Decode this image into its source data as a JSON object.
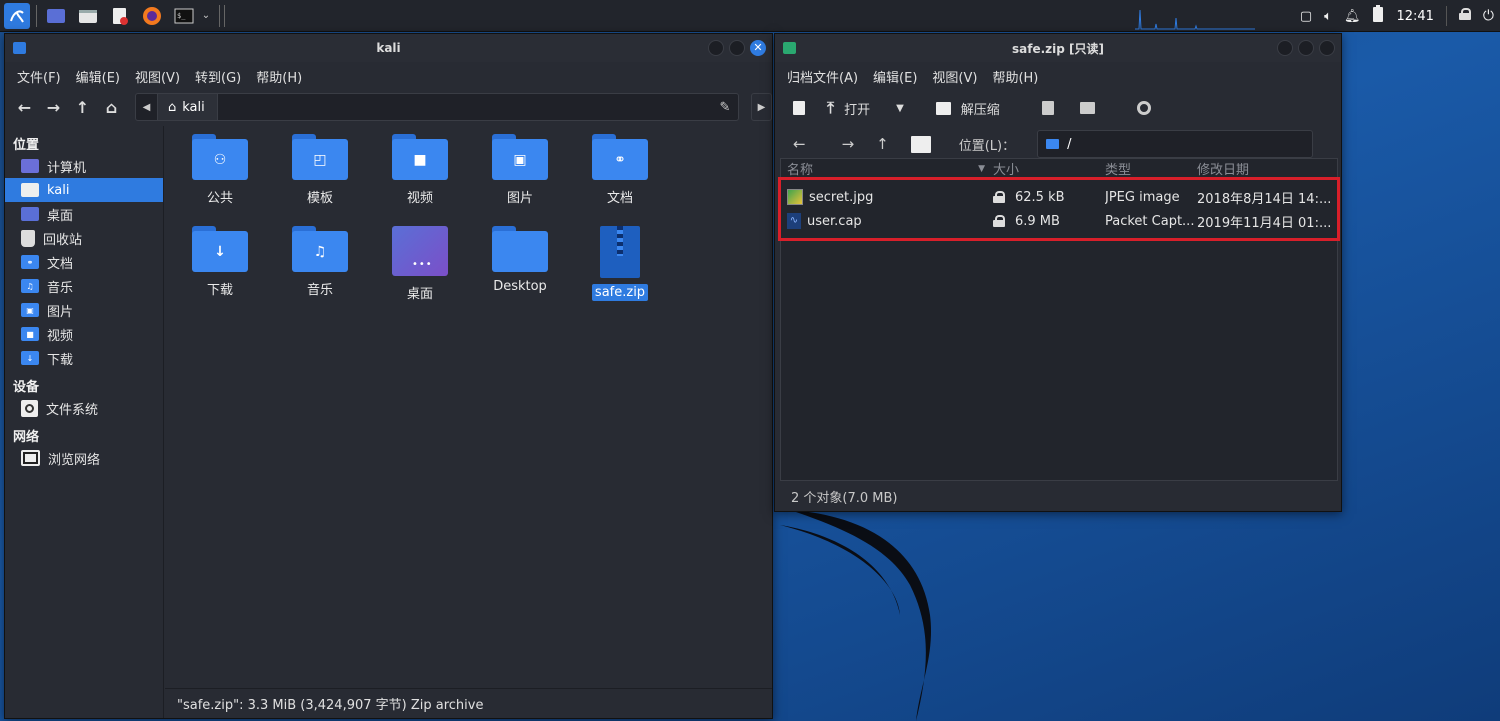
{
  "panel": {
    "clock": "12:41",
    "icons": [
      "kali-menu-icon",
      "desktop-icon",
      "file-manager-icon",
      "text-editor-icon",
      "firefox-icon",
      "terminal-icon"
    ]
  },
  "colors": {
    "accent": "#2f7be0",
    "folder": "#3b87f0",
    "highlight": "#d81f2a"
  },
  "filemanager": {
    "title": "kali",
    "menu": [
      "文件(F)",
      "编辑(E)",
      "视图(V)",
      "转到(G)",
      "帮助(H)"
    ],
    "path_crumb": "kali",
    "sidebar": {
      "places_header": "位置",
      "places": [
        "计算机",
        "kali",
        "桌面",
        "回收站",
        "文档",
        "音乐",
        "图片",
        "视频",
        "下载"
      ],
      "devices_header": "设备",
      "devices": [
        "文件系统"
      ],
      "network_header": "网络",
      "network": [
        "浏览网络"
      ]
    },
    "items": [
      "公共",
      "模板",
      "视频",
      "图片",
      "文档",
      "下载",
      "音乐",
      "桌面",
      "Desktop",
      "safe.zip"
    ],
    "status": "\"safe.zip\": 3.3 MiB (3,424,907 字节) Zip archive"
  },
  "archive": {
    "title": "safe.zip [只读]",
    "menu": [
      "归档文件(A)",
      "编辑(E)",
      "视图(V)",
      "帮助(H)"
    ],
    "toolbar": {
      "open": "打开",
      "extract": "解压缩"
    },
    "location_label": "位置(L)：",
    "location_value": "/",
    "columns": [
      "名称",
      "大小",
      "类型",
      "修改日期"
    ],
    "files": [
      {
        "name": "secret.jpg",
        "size": "62.5 kB",
        "type": "JPEG image",
        "date": "2018年8月14日 14:..."
      },
      {
        "name": "user.cap",
        "size": "6.9 MB",
        "type": "Packet Capt...",
        "date": "2019年11月4日 01:..."
      }
    ],
    "status": "2 个对象(7.0 MB)"
  }
}
